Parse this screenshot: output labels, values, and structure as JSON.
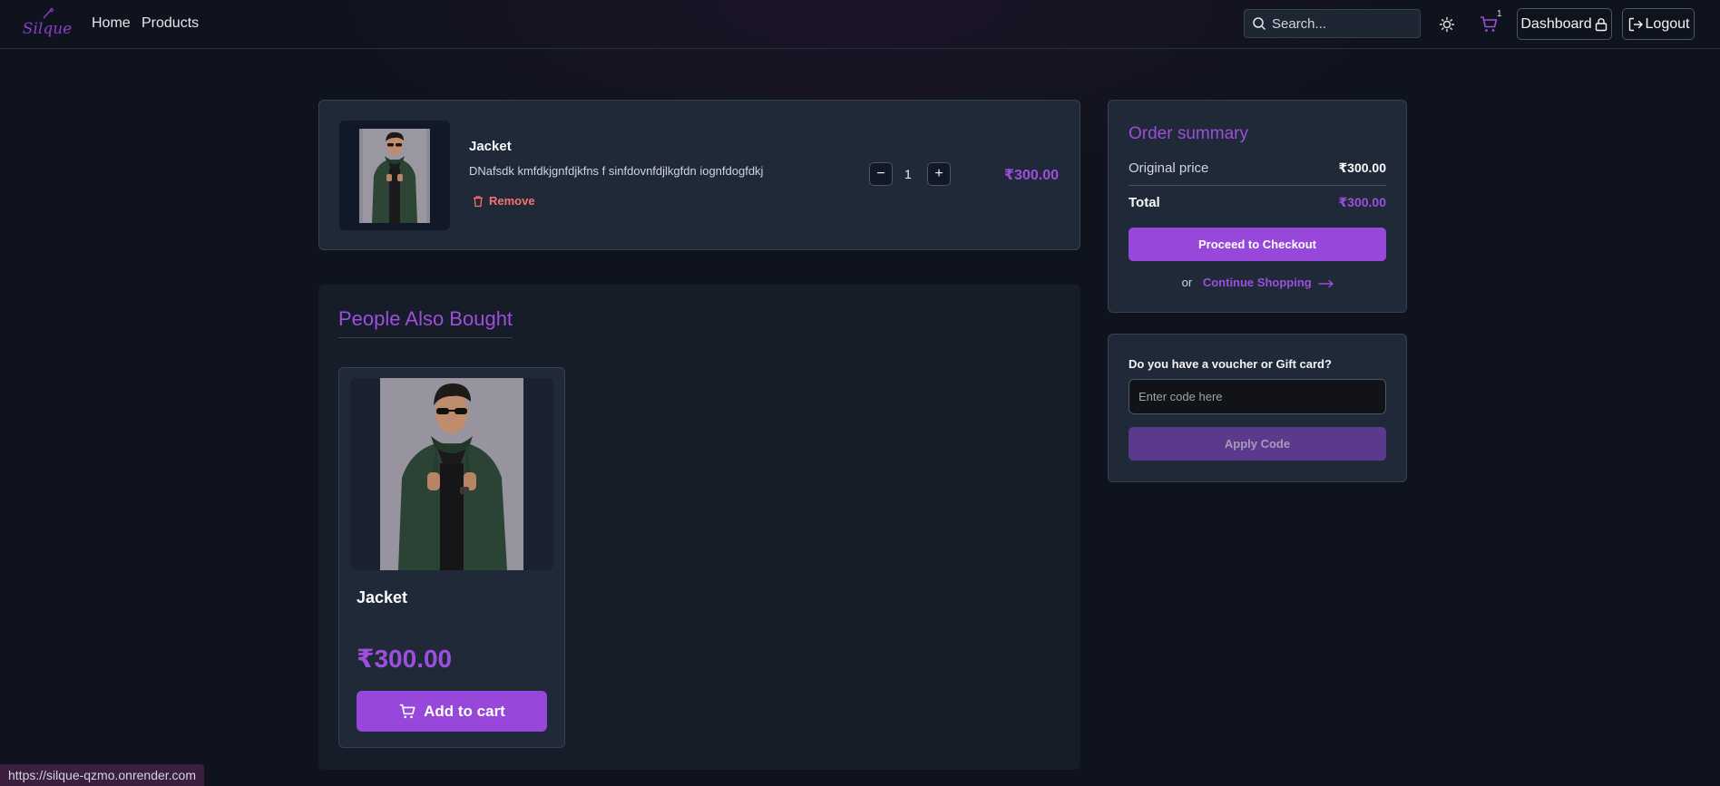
{
  "nav": {
    "logo_text": "Silque",
    "links": [
      {
        "label": "Home"
      },
      {
        "label": "Products"
      }
    ],
    "search_placeholder": "Search...",
    "cart_count": "1",
    "dashboard_label": "Dashboard",
    "logout_label": "Logout"
  },
  "cart": {
    "items": [
      {
        "title": "Jacket",
        "description": "DNafsdk kmfdkjgnfdjkfns f sinfdovnfdjlkgfdn iognfdogfdkj",
        "remove_label": "Remove",
        "quantity": "1",
        "price": "₹300.00"
      }
    ]
  },
  "summary": {
    "title": "Order summary",
    "original_price_label": "Original price",
    "original_price": "₹300.00",
    "total_label": "Total",
    "total": "₹300.00",
    "checkout_label": "Proceed to Checkout",
    "or_text": "or",
    "continue_label": "Continue Shopping"
  },
  "voucher": {
    "label": "Do you have a voucher or Gift card?",
    "placeholder": "Enter code here",
    "apply_label": "Apply Code"
  },
  "recommendations": {
    "title": "People Also Bought",
    "products": [
      {
        "name": "Jacket",
        "price": "₹300.00",
        "button_label": "Add to cart"
      }
    ]
  },
  "status_bar": {
    "url": "https://silque-qzmo.onrender.com"
  },
  "colors": {
    "accent": "#9d4edd",
    "button": "#9747d9",
    "danger": "#f87171",
    "background": "#0f131d",
    "card": "#1f2937"
  }
}
